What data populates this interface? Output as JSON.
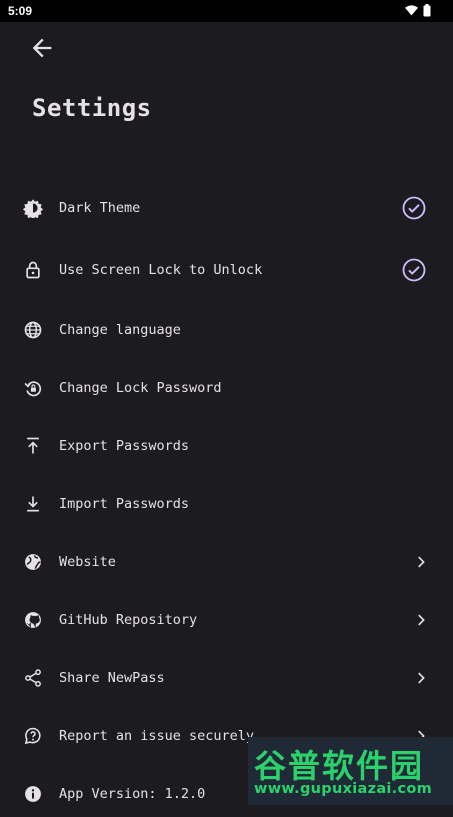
{
  "status_bar": {
    "time": "5:09"
  },
  "header": {
    "title": "Settings"
  },
  "settings": [
    {
      "label": "Dark Theme",
      "icon": "brightness-icon",
      "trailing": "check"
    },
    {
      "label": "Use Screen Lock to Unlock",
      "icon": "lock-icon",
      "trailing": "check"
    },
    {
      "label": "Change language",
      "icon": "globe-icon",
      "trailing": "none"
    },
    {
      "label": "Change Lock Password",
      "icon": "lock-reset-icon",
      "trailing": "none"
    },
    {
      "label": "Export Passwords",
      "icon": "upload-icon",
      "trailing": "none"
    },
    {
      "label": "Import Passwords",
      "icon": "download-icon",
      "trailing": "none"
    },
    {
      "label": "Website",
      "icon": "public-globe-icon",
      "trailing": "chevron"
    },
    {
      "label": "GitHub Repository",
      "icon": "github-icon",
      "trailing": "chevron"
    },
    {
      "label": "Share NewPass",
      "icon": "share-icon",
      "trailing": "chevron"
    },
    {
      "label": "Report an issue securely",
      "icon": "report-icon",
      "trailing": "chevron"
    },
    {
      "label": "App Version: 1.2.0",
      "icon": "info-icon",
      "trailing": "none"
    }
  ],
  "watermark": {
    "brand": "谷普软件园",
    "url": "www.gupuxiazai.com"
  },
  "colors": {
    "background": "#1c1b20",
    "accent": "#cfbcff",
    "text": "#e6e1e6",
    "watermark": "#2bd16b"
  }
}
